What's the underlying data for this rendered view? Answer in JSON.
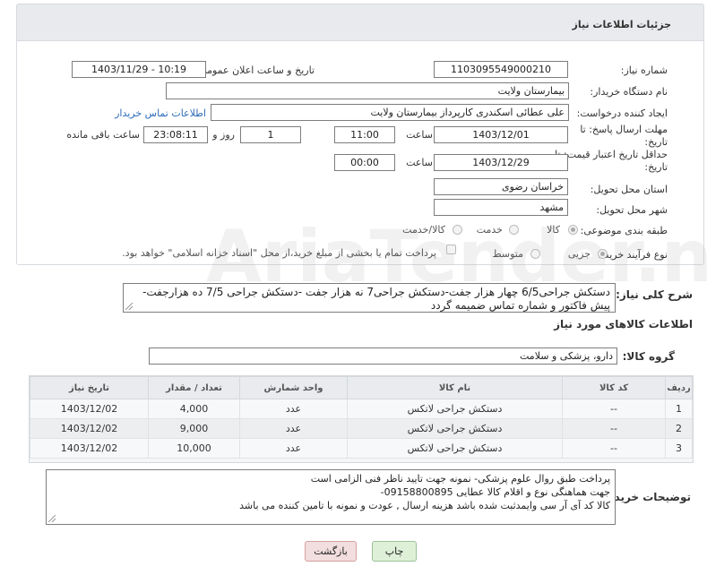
{
  "header": {
    "title": "جزئیات اطلاعات نیاز"
  },
  "fields": {
    "need_number_label": "شماره نیاز:",
    "need_number": "1103095549000210",
    "announce_label": "تاریخ و ساعت اعلان عمومی:",
    "announce_value": "1403/11/29 - 10:19",
    "buyer_label": "نام دستگاه خریدار:",
    "buyer_value": "بیمارستان ولایت",
    "creator_label": "ایجاد کننده درخواست:",
    "creator_value": "علی عطائی اسکندری کارپرداز بیمارستان ولایت",
    "contact_link": "اطلاعات تماس خریدار",
    "deadline_label": "مهلت ارسال پاسخ: تا تاریخ:",
    "deadline_date": "1403/12/01",
    "time_label": "ساعت",
    "deadline_time": "11:00",
    "days_count": "1",
    "days_label": "روز و",
    "remaining_time": "23:08:11",
    "remaining_label": "ساعت باقی مانده",
    "validity_label": "حداقل تاریخ اعتبار قیمت: تا تاریخ:",
    "validity_date": "1403/12/29",
    "validity_time": "00:00",
    "province_label": "استان محل تحویل:",
    "province_value": "خراسان رضوی",
    "city_label": "شهر محل تحویل:",
    "city_value": "مشهد",
    "category_label": "طبقه بندی موضوعی:",
    "category_options": [
      "کالا",
      "خدمت",
      "کالا/خدمت"
    ],
    "process_label": "نوع فرآیند خرید :",
    "process_options": [
      "جزیی",
      "متوسط"
    ],
    "payment_note": "پرداخت تمام یا بخشی از مبلغ خرید،از محل \"اسناد خزانه اسلامی\" خواهد بود."
  },
  "summary": {
    "label": "شرح کلی نیاز:",
    "text": "دستکش جراحی6/5 چهار هزار جفت-دستکش جراحی7 نه هزار جفت -دستکش جراحی 7/5 ده هزارجفت-\nپیش فاکتور و شماره تماس ضمیمه گردد"
  },
  "items_section": {
    "title": "اطلاعات کالاهای مورد نیاز",
    "group_label": "گروه کالا:",
    "group_value": "دارو، پزشکی و سلامت"
  },
  "table": {
    "headers": [
      "ردیف",
      "کد کالا",
      "نام کالا",
      "واحد شمارش",
      "تعداد / مقدار",
      "تاریخ نیاز"
    ],
    "rows": [
      [
        "1",
        "--",
        "دستکش جراحی لاتکس",
        "عدد",
        "4,000",
        "1403/12/02"
      ],
      [
        "2",
        "--",
        "دستکش جراحی لاتکس",
        "عدد",
        "9,000",
        "1403/12/02"
      ],
      [
        "3",
        "--",
        "دستکش جراحی لاتکس",
        "عدد",
        "10,000",
        "1403/12/02"
      ]
    ]
  },
  "buyer_notes": {
    "label": "توضیحات خریدار:",
    "text": "پرداخت طبق روال علوم پزشکی-  نمونه جهت تایید ناظر فنی الزامی است\nجهت هماهنگی نوع و اقلام کالا  عطایی 09158800895-\nکالا کد آی آر سی وایمدثبت شده باشد هزینه ارسال , عودت و نمونه با تامین کننده می باشد"
  },
  "buttons": {
    "print": "چاپ",
    "back": "بازگشت"
  },
  "watermark": "AriaTender.net",
  "colors": {
    "link": "#2e6bb8",
    "print_btn": "#dff0d8",
    "back_btn": "#f2dede"
  }
}
